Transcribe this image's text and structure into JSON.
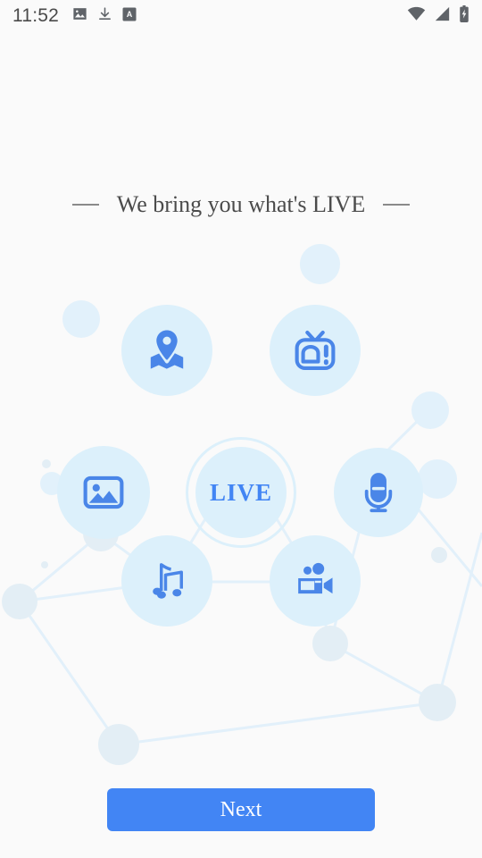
{
  "status_bar": {
    "time": "11:52",
    "left_icons": [
      "image-icon",
      "download-icon",
      "app-letter-a-icon"
    ],
    "right_icons": [
      "wifi-icon",
      "cell-signal-icon",
      "battery-charging-icon"
    ]
  },
  "headline": {
    "text": "We bring you what's LIVE",
    "left_dash": "—",
    "right_dash": "—"
  },
  "center_node": {
    "label": "LIVE"
  },
  "feature_nodes": [
    {
      "name": "location-icon",
      "label": "Location"
    },
    {
      "name": "tv-icon",
      "label": "TV"
    },
    {
      "name": "photo-icon",
      "label": "Photos"
    },
    {
      "name": "microphone-icon",
      "label": "Audio"
    },
    {
      "name": "music-icon",
      "label": "Music"
    },
    {
      "name": "video-camera-icon",
      "label": "Video"
    }
  ],
  "footer": {
    "next_label": "Next"
  },
  "colors": {
    "background": "#fafafa",
    "accent_blue": "#4285f4",
    "bubble_light": "#dcf0fb",
    "line_light": "#e2f0fa",
    "headline_text": "#4b4b4b",
    "status_text": "#4a4a4a"
  }
}
